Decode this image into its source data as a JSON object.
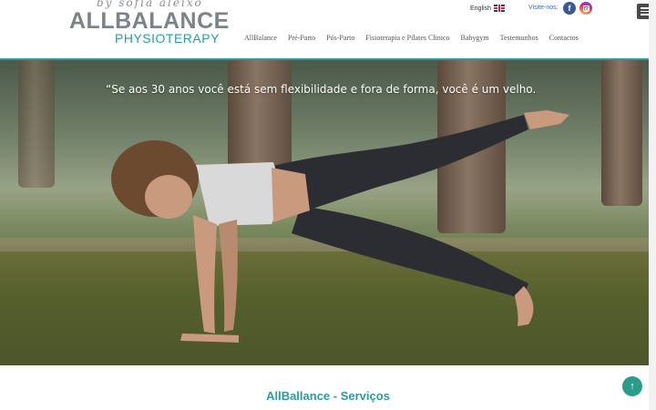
{
  "header": {
    "logo_script": "by sofia aleixo",
    "logo_main": "ALLBALANCE",
    "logo_sub": "PHYSIOTERAPY",
    "language_label": "English",
    "visit_label": "Visite-nos:"
  },
  "nav": {
    "items": [
      {
        "label": "AllBalance"
      },
      {
        "label": "Pré-Parto"
      },
      {
        "label": "Pós-Parto"
      },
      {
        "label": "Fisioterapia e Pilates Clinico"
      },
      {
        "label": "Babygym"
      },
      {
        "label": "Testemunhos"
      },
      {
        "label": "Contactos"
      }
    ]
  },
  "hero": {
    "quote": "“Se aos 30 anos você está sem flexibilidade e fora de forma, você é um velho."
  },
  "services": {
    "title": "AllBallance - Serviços"
  },
  "colors": {
    "accent": "#2a9c9f",
    "logo_gray": "#7b8488",
    "facebook": "#3b5998",
    "scroll_button": "#2a9c8a"
  },
  "icons": {
    "facebook": "facebook-icon",
    "instagram": "instagram-icon",
    "menu": "hamburger-menu-icon",
    "flag": "uk-flag-icon",
    "scroll_top": "arrow-up-icon"
  }
}
